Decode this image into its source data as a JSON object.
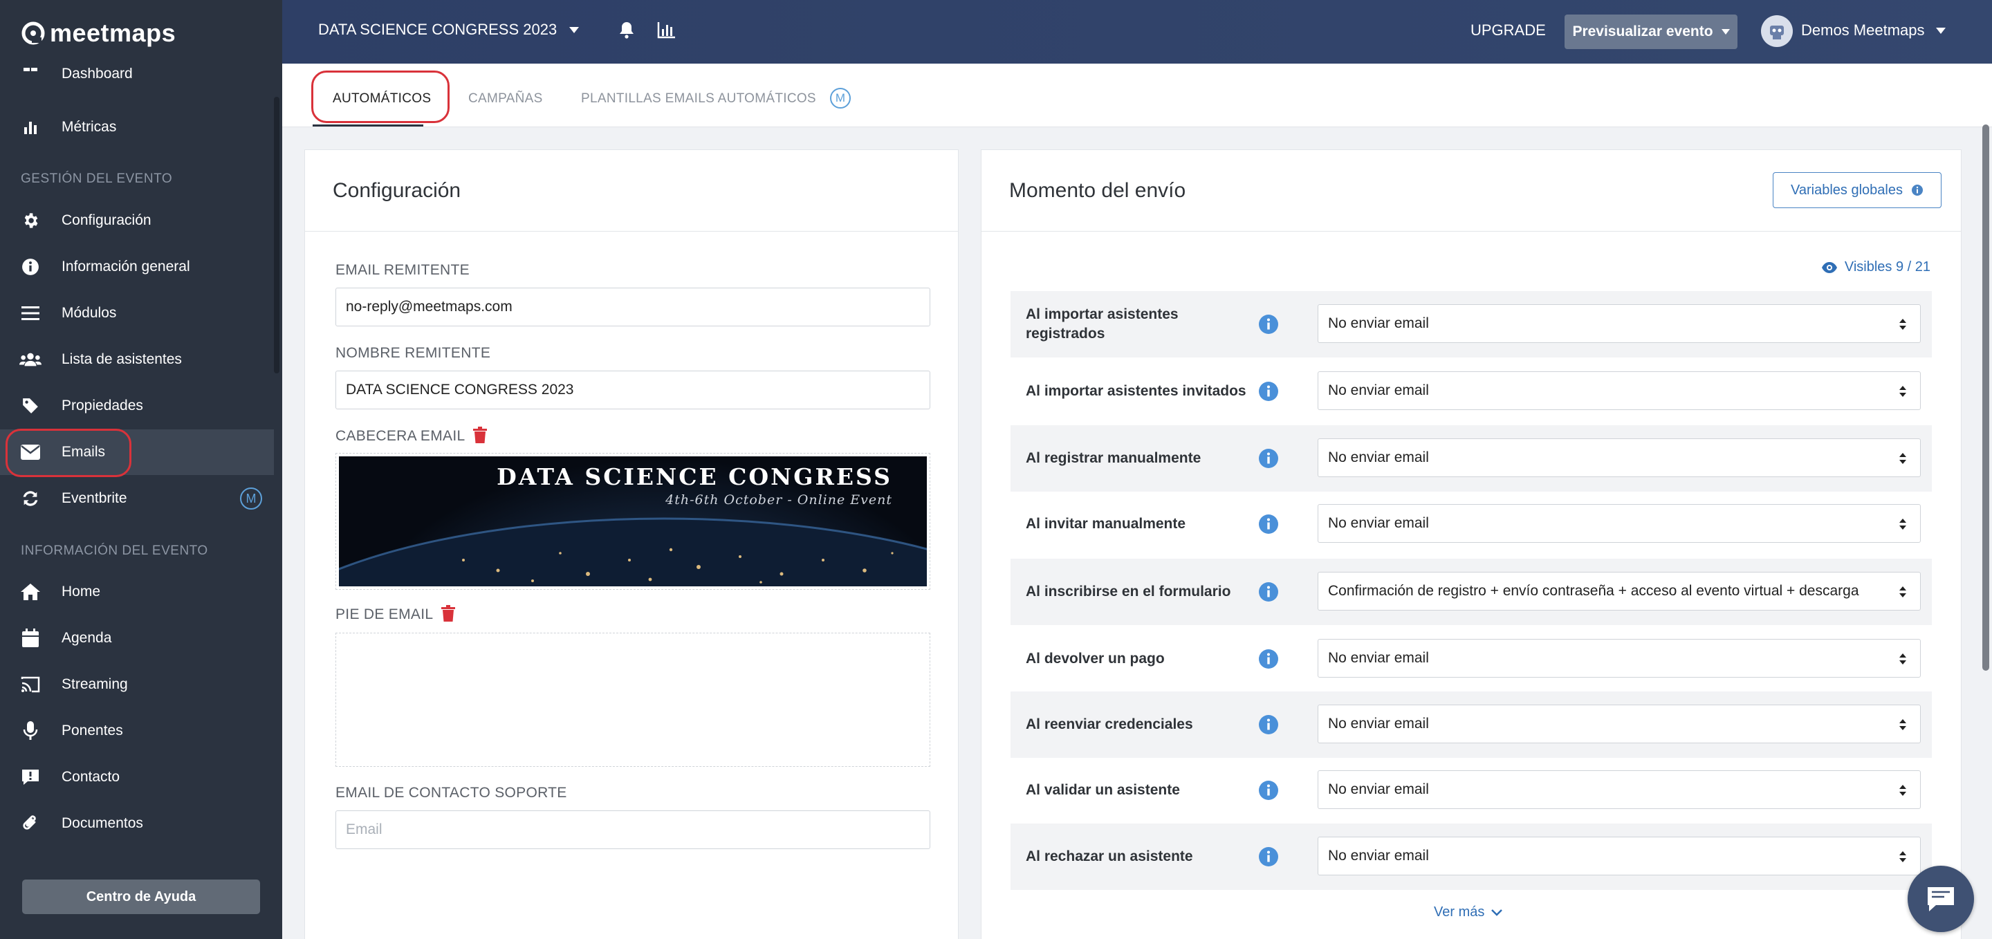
{
  "app": {
    "logo_text": "meetmaps"
  },
  "sidebar": {
    "partial_item": {
      "label": "Dashboard"
    },
    "items": [
      {
        "label": "Métricas",
        "icon": "bar-chart-icon"
      },
      {
        "label": "Configuración",
        "icon": "gear-icon"
      },
      {
        "label": "Información general",
        "icon": "info-circle-icon"
      },
      {
        "label": "Módulos",
        "icon": "list-icon"
      },
      {
        "label": "Lista de asistentes",
        "icon": "users-icon"
      },
      {
        "label": "Propiedades",
        "icon": "tag-icon"
      },
      {
        "label": "Emails",
        "icon": "envelope-icon"
      },
      {
        "label": "Eventbrite",
        "icon": "sync-icon",
        "badge": "M"
      },
      {
        "label": "Home",
        "icon": "home-icon"
      },
      {
        "label": "Agenda",
        "icon": "calendar-icon"
      },
      {
        "label": "Streaming",
        "icon": "cast-icon"
      },
      {
        "label": "Ponentes",
        "icon": "microphone-icon"
      },
      {
        "label": "Contacto",
        "icon": "message-icon"
      },
      {
        "label": "Documentos",
        "icon": "paperclip-icon"
      }
    ],
    "sections": {
      "event_management": "GESTIÓN DEL EVENTO",
      "event_info": "INFORMACIÓN DEL EVENTO"
    },
    "help_button": "Centro de Ayuda",
    "active_item": "Emails"
  },
  "topbar": {
    "event_name": "DATA SCIENCE CONGRESS 2023",
    "upgrade": "UPGRADE",
    "preview_button": "Previsualizar evento",
    "user_name": "Demos Meetmaps"
  },
  "tabs": [
    {
      "label": "AUTOMÁTICOS",
      "active": true
    },
    {
      "label": "CAMPAÑAS",
      "active": false
    },
    {
      "label": "PLANTILLAS EMAILS AUTOMÁTICOS",
      "active": false,
      "badge": "M"
    }
  ],
  "config_card": {
    "title": "Configuración",
    "sender_email_label": "EMAIL REMITENTE",
    "sender_email_value": "no-reply@meetmaps.com",
    "sender_name_label": "NOMBRE REMITENTE",
    "sender_name_value": "DATA SCIENCE CONGRESS 2023",
    "header_label": "CABECERA EMAIL",
    "banner_title": "DATA SCIENCE CONGRESS",
    "banner_subtitle": "4th-6th October - Online Event",
    "footer_label": "PIE DE EMAIL",
    "support_email_label": "EMAIL DE CONTACTO SOPORTE",
    "support_email_placeholder": "Email"
  },
  "send_card": {
    "title": "Momento del envío",
    "global_vars_button": "Variables globales",
    "visibles": "Visibles 9 / 21",
    "rows": [
      {
        "label": "Al importar asistentes registrados",
        "value": "No enviar email"
      },
      {
        "label": "Al importar asistentes invitados",
        "value": "No enviar email"
      },
      {
        "label": "Al registrar manualmente",
        "value": "No enviar email"
      },
      {
        "label": "Al invitar manualmente",
        "value": "No enviar email"
      },
      {
        "label": "Al inscribirse en el formulario",
        "value": "Confirmación de registro + envío contraseña + acceso al evento virtual + descarga"
      },
      {
        "label": "Al devolver un pago",
        "value": "No enviar email"
      },
      {
        "label": "Al reenviar credenciales",
        "value": "No enviar email"
      },
      {
        "label": "Al validar un asistente",
        "value": "No enviar email"
      },
      {
        "label": "Al rechazar un asistente",
        "value": "No enviar email"
      }
    ],
    "see_more": "Ver más"
  },
  "colors": {
    "sidebar_bg": "#2b3340",
    "topbar_bg": "#2e3f66",
    "accent": "#2f6eb5",
    "highlight_ring": "#d9323a",
    "delete_red": "#d9323a"
  }
}
